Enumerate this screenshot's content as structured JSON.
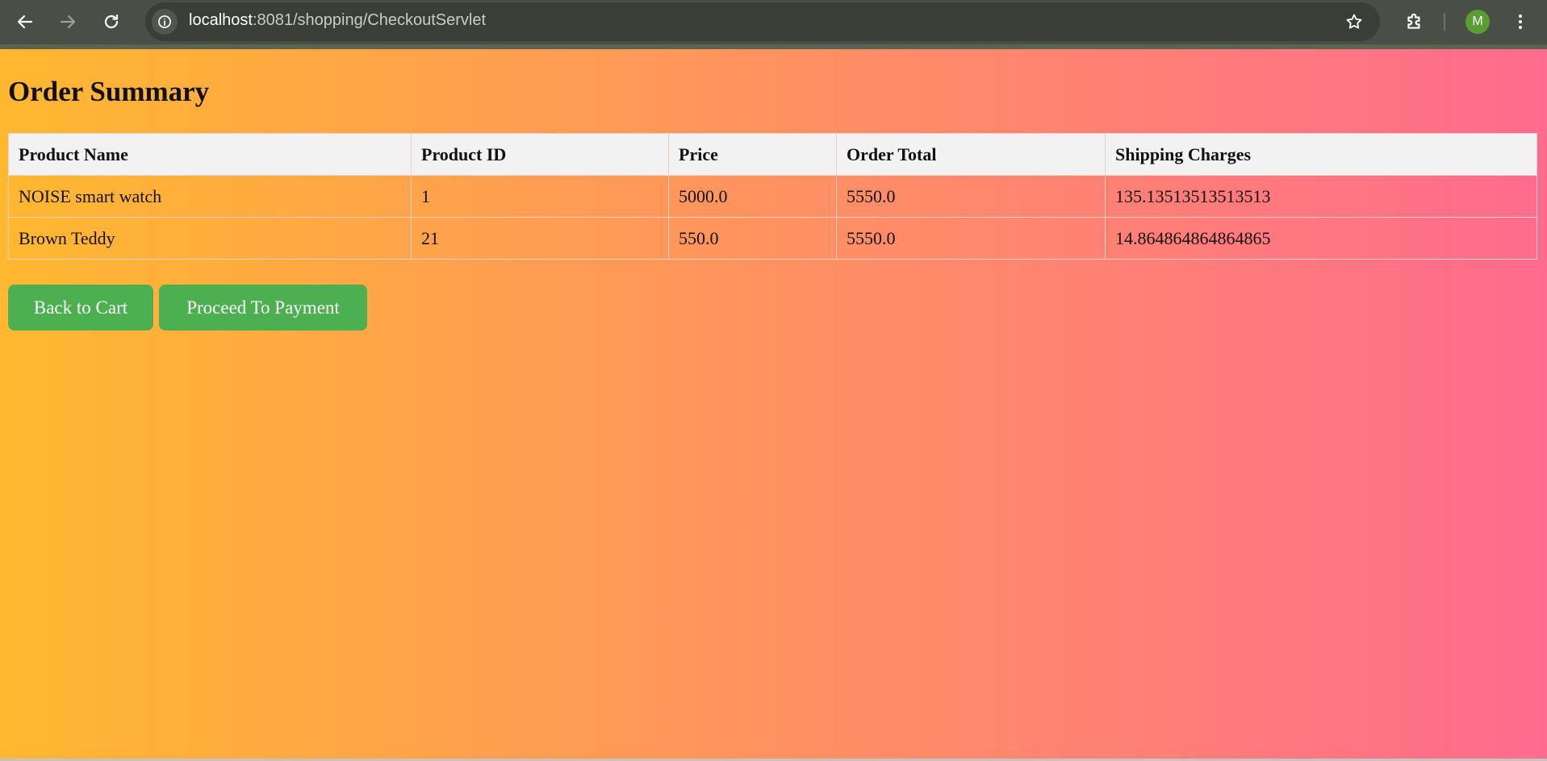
{
  "browser": {
    "url_host": "localhost",
    "url_path": ":8081/shopping/CheckoutServlet",
    "profile_initial": "M",
    "icons": {
      "back": "arrow-left-icon",
      "forward": "arrow-right-icon",
      "reload": "reload-icon",
      "site_info": "info-icon",
      "bookmark": "star-icon",
      "extensions": "puzzle-icon",
      "menu": "kebab-menu-icon"
    }
  },
  "page": {
    "title": "Order Summary",
    "background_colors": [
      "#ffb830",
      "#ff8a6a",
      "#ff6b8e"
    ]
  },
  "table": {
    "headers": [
      "Product Name",
      "Product ID",
      "Price",
      "Order Total",
      "Shipping Charges"
    ],
    "rows": [
      [
        "NOISE smart watch",
        "1",
        "5000.0",
        "5550.0",
        "135.13513513513513"
      ],
      [
        "Brown Teddy",
        "21",
        "550.0",
        "5550.0",
        "14.864864864864865"
      ]
    ]
  },
  "buttons": {
    "back_to_cart": "Back to Cart",
    "proceed_to_payment": "Proceed To Payment",
    "color": "#4caf50"
  }
}
